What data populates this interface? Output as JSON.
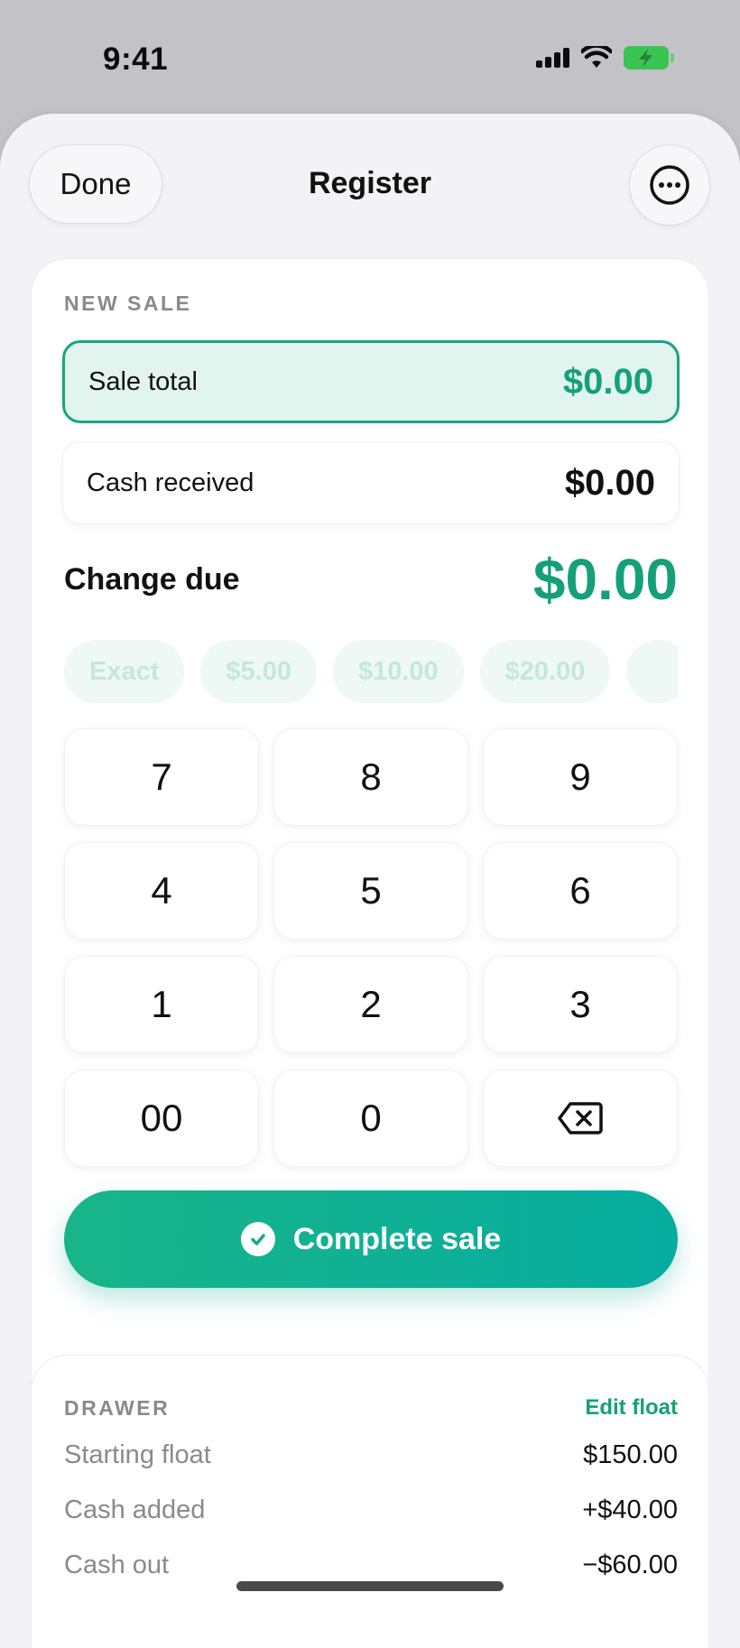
{
  "status": {
    "time": "9:41"
  },
  "nav": {
    "done_label": "Done",
    "title": "Register"
  },
  "sale": {
    "section_label": "NEW SALE",
    "total_label": "Sale total",
    "total_value": "$0.00",
    "cash_label": "Cash received",
    "cash_value": "$0.00",
    "change_label": "Change due",
    "change_value": "$0.00",
    "chips": [
      "Exact",
      "$5.00",
      "$10.00",
      "$20.00"
    ]
  },
  "keypad": {
    "keys": [
      "7",
      "8",
      "9",
      "4",
      "5",
      "6",
      "1",
      "2",
      "3",
      "00",
      "0"
    ],
    "backspace_icon": "backspace-icon"
  },
  "complete_label": "Complete sale",
  "drawer": {
    "section_label": "DRAWER",
    "edit_label": "Edit float",
    "rows": [
      {
        "label": "Starting float",
        "value": "$150.00"
      },
      {
        "label": "Cash added",
        "value": "+$40.00"
      },
      {
        "label": "Cash out",
        "value": "−$60.00"
      }
    ]
  },
  "colors": {
    "accent": "#15a07a",
    "accent_light": "#e1f4ee"
  }
}
